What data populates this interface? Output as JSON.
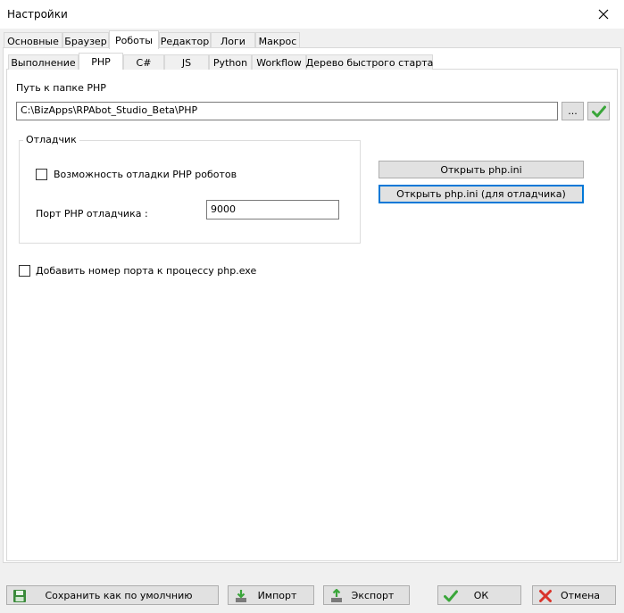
{
  "window": {
    "title": "Настройки"
  },
  "main_tabs": [
    {
      "label": "Основные"
    },
    {
      "label": "Браузер"
    },
    {
      "label": "Роботы"
    },
    {
      "label": "Редактор"
    },
    {
      "label": "Логи"
    },
    {
      "label": "Макрос"
    }
  ],
  "sub_tabs": [
    {
      "label": "Выполнение"
    },
    {
      "label": "PHP"
    },
    {
      "label": "C#"
    },
    {
      "label": "JS"
    },
    {
      "label": "Python"
    },
    {
      "label": "Workflow"
    },
    {
      "label": "Дерево быстрого старта"
    }
  ],
  "php": {
    "path_label": "Путь к папке PHP",
    "path_value": "C:\\BizApps\\RPAbot_Studio_Beta\\PHP",
    "browse_label": "...",
    "debugger": {
      "group_label": "Отладчик",
      "enable_label": "Возможность отладки  PHP роботов",
      "port_label": "Порт PHP отладчика :",
      "port_value": "9000"
    },
    "open_ini_label": "Открыть php.ini",
    "open_ini_debug_label": "Открыть php.ini (для отладчика)",
    "add_port_label": "Добавить номер порта к процессу php.exe"
  },
  "footer": {
    "save_default_label": "Сохранить как по умолчнию",
    "import_label": "Импорт",
    "export_label": "Экспорт",
    "ok_label": "ОК",
    "cancel_label": "Отмена"
  },
  "colors": {
    "accent": "#0078d7",
    "ok_green": "#3aa63a",
    "cancel_red": "#d9342b"
  }
}
